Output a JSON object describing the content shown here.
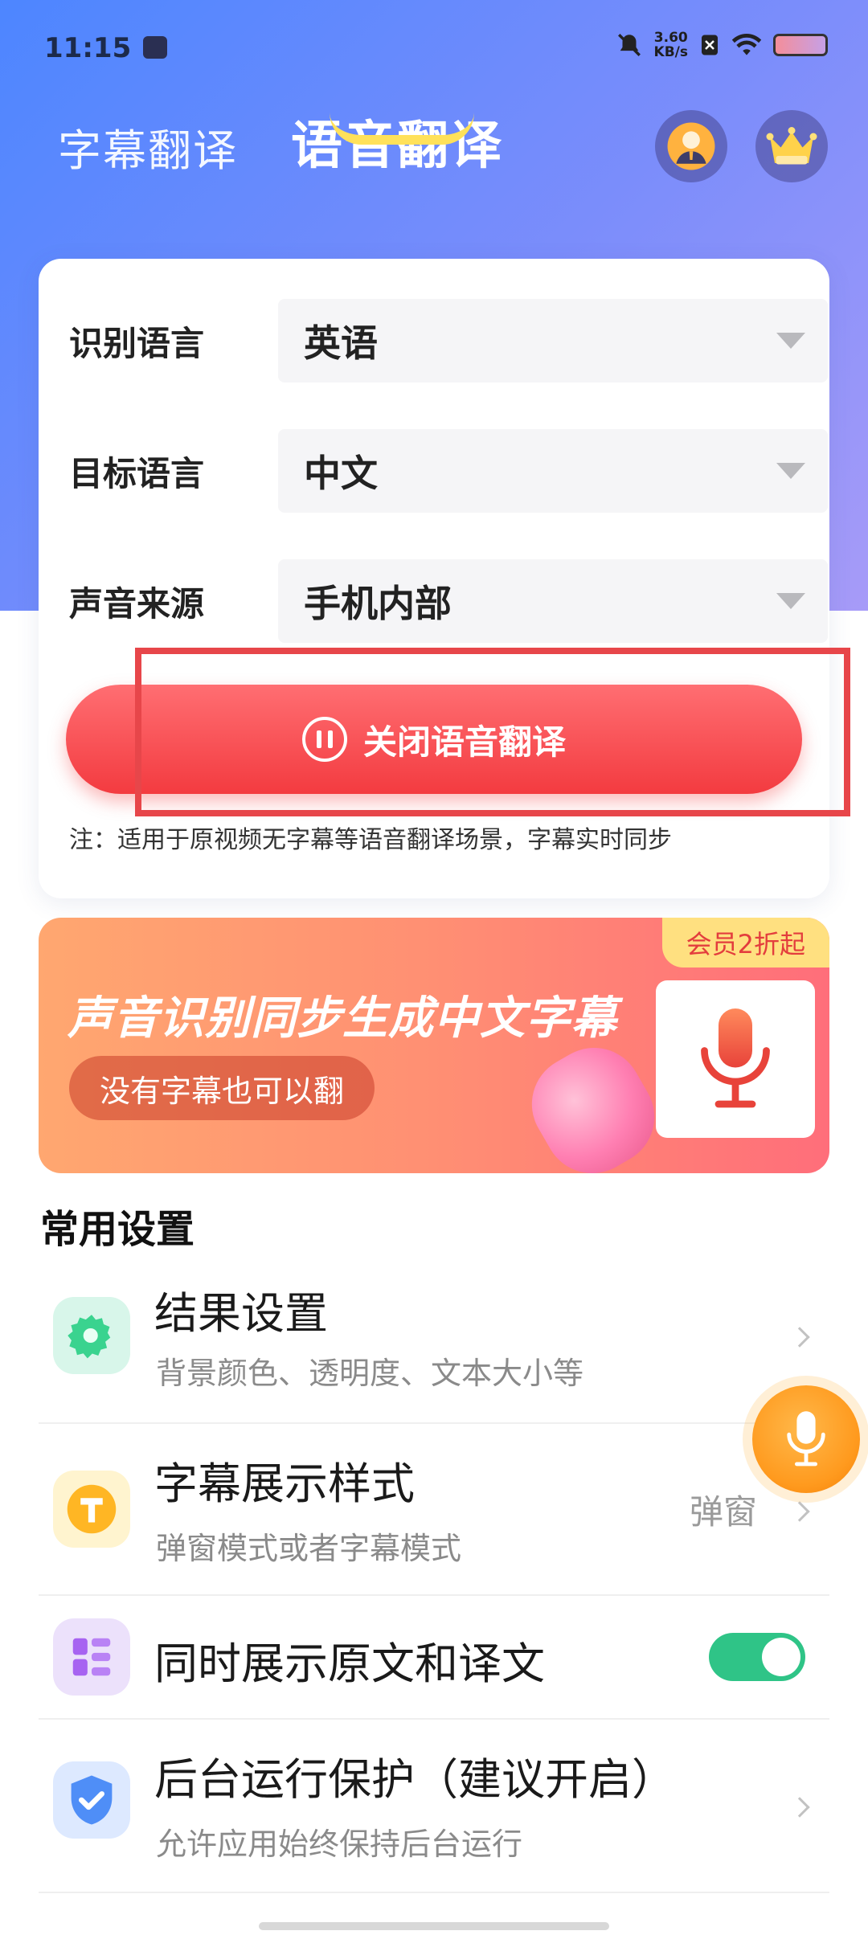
{
  "status_bar": {
    "time": "11:15",
    "net_speed_value": "3.60",
    "net_speed_unit": "KB/s"
  },
  "header": {
    "tabs": [
      {
        "label": "字幕翻译",
        "active": false
      },
      {
        "label": "语音翻译",
        "active": true
      }
    ],
    "icons": [
      "user-avatar-icon",
      "vip-crown-icon"
    ]
  },
  "card": {
    "rows": [
      {
        "label": "识别语言",
        "value": "英语"
      },
      {
        "label": "目标语言",
        "value": "中文"
      },
      {
        "label": "声音来源",
        "value": "手机内部"
      }
    ],
    "button_label": "关闭语音翻译",
    "note": "注：适用于原视频无字幕等语音翻译场景，字幕实时同步"
  },
  "banner": {
    "badge": "会员2折起",
    "title": "声音识别同步生成中文字幕",
    "pill": "没有字幕也可以翻"
  },
  "settings": {
    "section_title": "常用设置",
    "items": [
      {
        "title": "结果设置",
        "subtitle": "背景颜色、透明度、文本大小等",
        "icon": "gear-icon"
      },
      {
        "title": "字幕展示样式",
        "subtitle": "弹窗模式或者字幕模式",
        "value": "弹窗",
        "icon": "text-t-icon"
      },
      {
        "title": "同时展示原文和译文",
        "toggle": true,
        "icon": "layout-icon"
      },
      {
        "title": "后台运行保护（建议开启）",
        "subtitle": "允许应用始终保持后台运行",
        "icon": "shield-icon"
      }
    ]
  },
  "colors": {
    "accent_red": "#f33b40",
    "toggle_green": "#2fc487",
    "fab_orange": "#ff9a1e"
  }
}
